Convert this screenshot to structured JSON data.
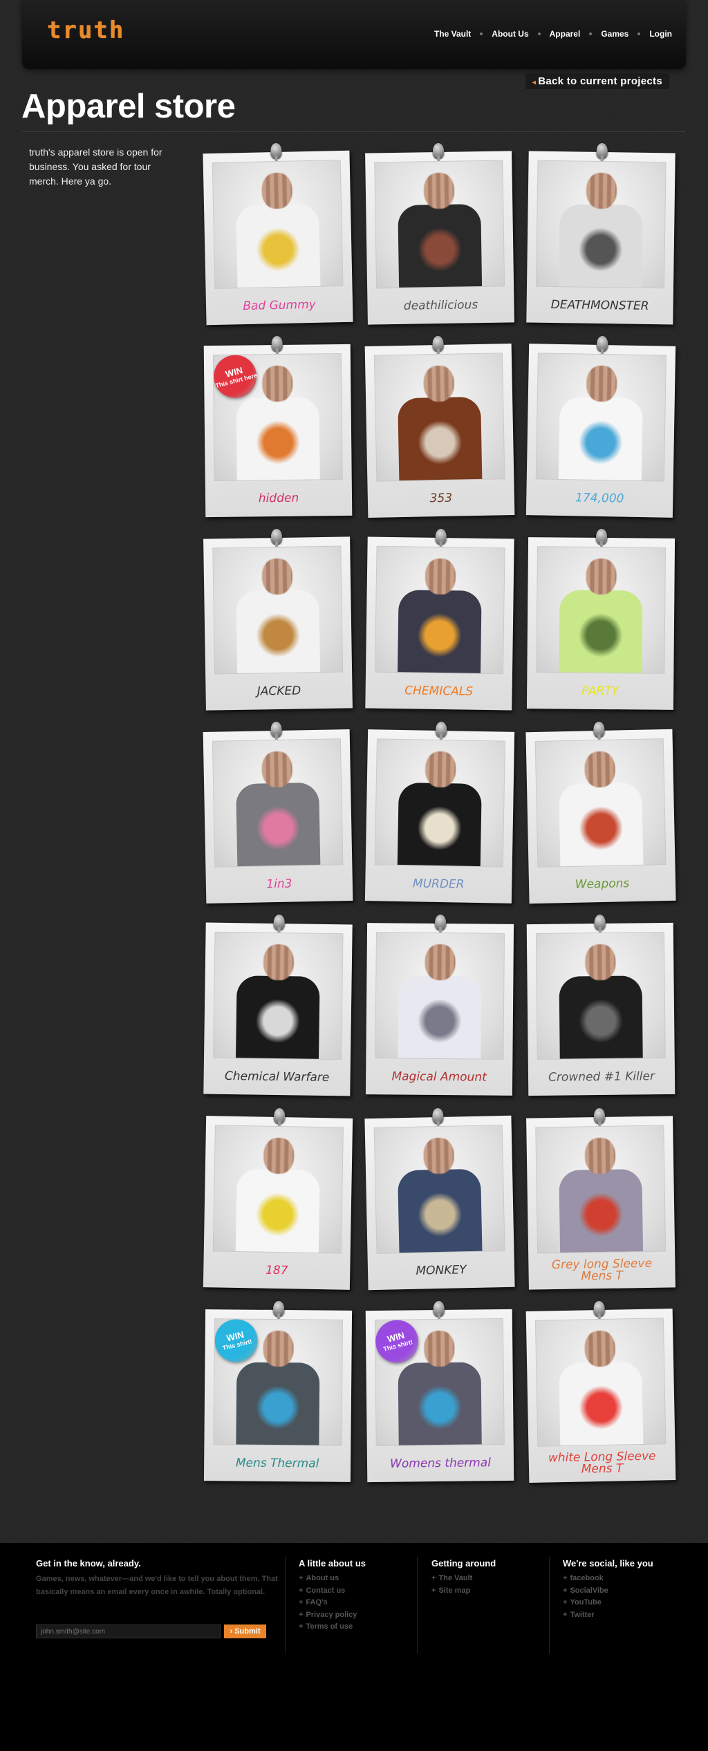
{
  "header": {
    "logo": "truth",
    "nav": [
      "The Vault",
      "About Us",
      "Apparel",
      "Games",
      "Login"
    ]
  },
  "back_link": "Back to current projects",
  "page_title": "Apparel store",
  "intro": "truth's apparel store is open for business. You asked for tour merch. Here ya go.",
  "products": [
    {
      "caption": "Bad Gummy",
      "color": "#e0409a",
      "shirt": "#f2f2f2",
      "print": "#e8c23a"
    },
    {
      "caption": "deathilicious",
      "color": "#555555",
      "shirt": "#2a2a2a",
      "print": "#8a4a3a"
    },
    {
      "caption": "DEATHMONSTER",
      "color": "#333333",
      "shirt": "#dcdcdc",
      "print": "#555555"
    },
    {
      "caption": "hidden",
      "color": "#d0306a",
      "shirt": "#f4f4f4",
      "print": "#e07a30",
      "badge": {
        "line1": "WIN",
        "line2": "This shirt here",
        "color": "#e2343f"
      }
    },
    {
      "caption": "353",
      "color": "#6a3a2a",
      "shirt": "#7a3a1e",
      "print": "#d8c8b8"
    },
    {
      "caption": "174,000",
      "color": "#4aa8d8",
      "shirt": "#f6f6f6",
      "print": "#4aa8d8"
    },
    {
      "caption": "JACKED",
      "color": "#333333",
      "shirt": "#f2f2f2",
      "print": "#c08840"
    },
    {
      "caption": "CHEMICALS",
      "color": "#f07a20",
      "shirt": "#3a3a4a",
      "print": "#e8a030"
    },
    {
      "caption": "PARTY",
      "color": "#e6e61a",
      "shirt": "#c8e88a",
      "print": "#5a7a3a"
    },
    {
      "caption": "1in3",
      "color": "#e0409a",
      "shirt": "#7a7a80",
      "print": "#e07aa0"
    },
    {
      "caption": "MURDER",
      "color": "#7090c0",
      "shirt": "#1a1a1a",
      "print": "#e8e0cc"
    },
    {
      "caption": "Weapons",
      "color": "#6a9a3a",
      "shirt": "#f4f4f4",
      "print": "#c84a30"
    },
    {
      "caption": "Chemical Warfare",
      "color": "#333333",
      "shirt": "#1a1a1a",
      "print": "#d8d8d8"
    },
    {
      "caption": "Magical Amount",
      "color": "#b03030",
      "shirt": "#e8e8f0",
      "print": "#7a7a8a"
    },
    {
      "caption": "Crowned #1 Killer",
      "color": "#555555",
      "shirt": "#1e1e1e",
      "print": "#6a6a6a"
    },
    {
      "caption": "187",
      "color": "#e0305a",
      "shirt": "#f6f6f6",
      "print": "#e8d030"
    },
    {
      "caption": "MONKEY",
      "color": "#333333",
      "shirt": "#3a4a6a",
      "print": "#c8b896"
    },
    {
      "caption": "Grey long Sleeve Mens T",
      "color": "#e07a3a",
      "shirt": "#9a92a8",
      "print": "#d04030"
    },
    {
      "caption": "Mens Thermal",
      "color": "#2a8a8a",
      "shirt": "#4a545a",
      "print": "#3aa0d0",
      "badge": {
        "line1": "WIN",
        "line2": "This shirt!",
        "color": "#28b6e0"
      }
    },
    {
      "caption": "Womens thermal",
      "color": "#8a3ab0",
      "shirt": "#5a5a6a",
      "print": "#3aa0d0",
      "badge": {
        "line1": "WIN",
        "line2": "This shirt!",
        "color": "#9a4ae0"
      }
    },
    {
      "caption": "white Long Sleeve Mens T",
      "color": "#e0403a",
      "shirt": "#f4f4f4",
      "print": "#e8403a"
    }
  ],
  "footer": {
    "newsletter": {
      "heading": "Get in the know, already.",
      "text": "Games, news, whatever—and we'd like to tell you about them. That basically means an email every once in awhile. Totally optional.",
      "email_placeholder": "john.smith@site.com",
      "submit_label": "› Submit"
    },
    "about": {
      "heading": "A little about us",
      "links": [
        "About us",
        "Contact us",
        "FAQ's",
        "Privacy policy",
        "Terms of use"
      ]
    },
    "around": {
      "heading": "Getting around",
      "links": [
        "The Vault",
        "Site map"
      ]
    },
    "social": {
      "heading": "We're social, like you",
      "links": [
        "facebook",
        "SocialVibe",
        "YouTube",
        "Twitter"
      ]
    }
  }
}
